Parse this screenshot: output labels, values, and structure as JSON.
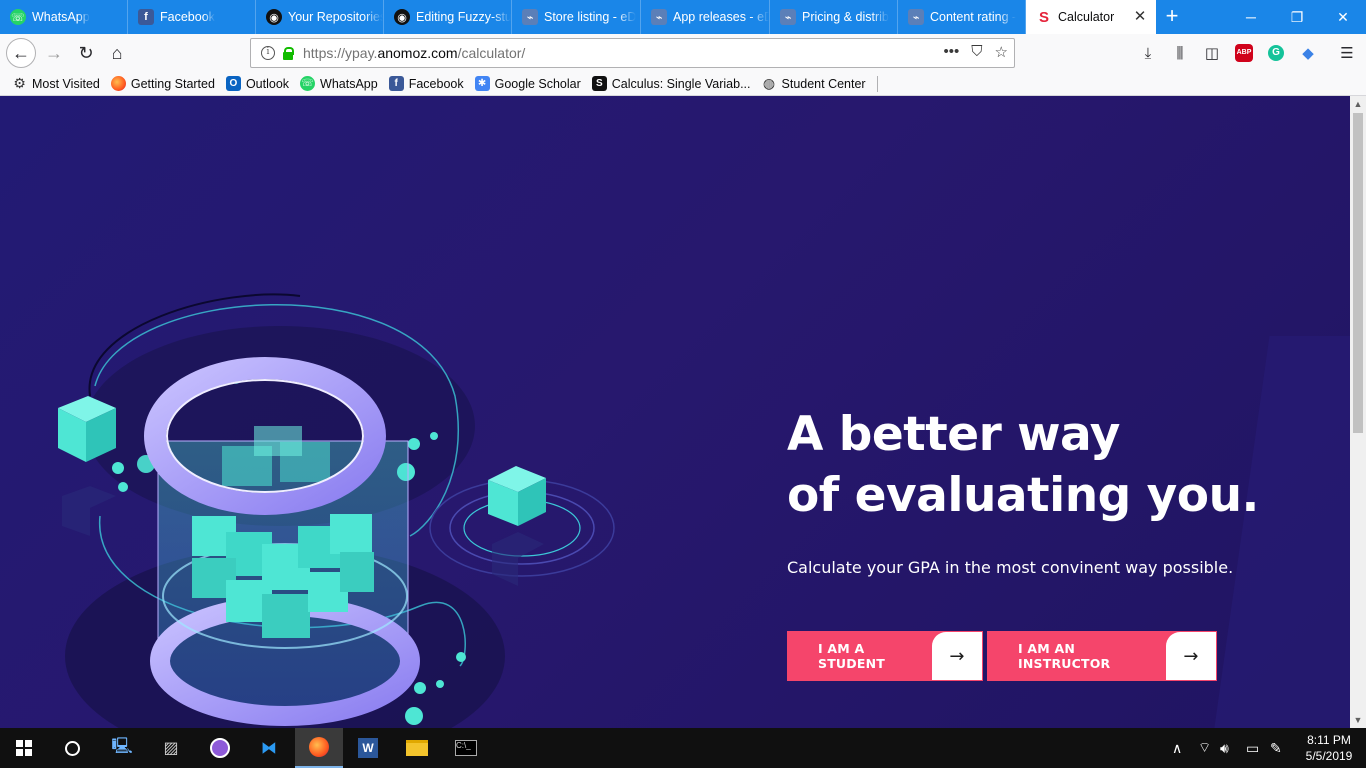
{
  "browser": {
    "tabs": [
      {
        "title": "WhatsApp",
        "icon": "whatsapp-icon"
      },
      {
        "title": "Facebook",
        "icon": "facebook-icon"
      },
      {
        "title": "Your Repositories",
        "icon": "github-icon"
      },
      {
        "title": "Editing Fuzzy-stu",
        "icon": "github-icon"
      },
      {
        "title": "Store listing - eD",
        "icon": "play-console-icon"
      },
      {
        "title": "App releases - eD",
        "icon": "play-console-icon"
      },
      {
        "title": "Pricing & distrib",
        "icon": "play-console-icon"
      },
      {
        "title": "Content rating -",
        "icon": "play-console-icon"
      },
      {
        "title": "Calculator",
        "icon": "site-s-icon"
      }
    ],
    "url_prefix": "https://ypay.",
    "url_domain": "anomoz.com",
    "url_path": "/calculator/",
    "bookmarks": [
      {
        "label": "Most Visited",
        "icon": "gear-icon"
      },
      {
        "label": "Getting Started",
        "icon": "firefox-icon"
      },
      {
        "label": "Outlook",
        "icon": "outlook-icon"
      },
      {
        "label": "WhatsApp",
        "icon": "whatsapp-icon"
      },
      {
        "label": "Facebook",
        "icon": "facebook-icon"
      },
      {
        "label": "Google Scholar",
        "icon": "scholar-icon"
      },
      {
        "label": "Calculus: Single Variab...",
        "icon": "coursera-s-icon"
      },
      {
        "label": "Student Center",
        "icon": "globe-icon"
      }
    ]
  },
  "hero": {
    "title_line1": "A better way",
    "title_line2": "of evaluating you.",
    "subtitle": "Calculate your GPA in the most convinent way possible.",
    "student_button": "I AM A STUDENT",
    "instructor_button": "I AM AN INSTRUCTOR"
  },
  "taskbar": {
    "time": "8:11 PM",
    "date": "5/5/2019"
  },
  "colors": {
    "tab_strip": "#1a86e8",
    "page_background": "#251a6e",
    "cta": "#f5456b",
    "accent_cyan": "#4ee6d4"
  }
}
